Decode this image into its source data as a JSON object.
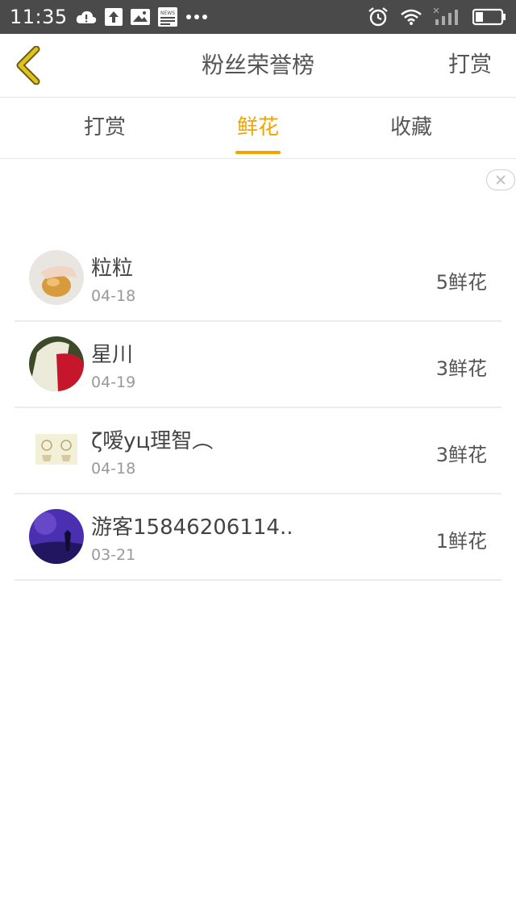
{
  "status_bar": {
    "time": "11:35",
    "icons": [
      "cloud-alert-icon",
      "upload-icon",
      "image-icon",
      "news-icon",
      "more-dots-icon"
    ],
    "right_icons": [
      "alarm-icon",
      "wifi-icon",
      "signal-icon",
      "battery-icon"
    ],
    "news_label": "NEWS"
  },
  "header": {
    "title": "粉丝荣誉榜",
    "action": "打赏",
    "accent": "#c8a300"
  },
  "tabs": [
    {
      "label": "打赏",
      "active": false
    },
    {
      "label": "鲜花",
      "active": true
    },
    {
      "label": "收藏",
      "active": false
    }
  ],
  "accent_color": "#f0a500",
  "list": [
    {
      "name": "粒粒",
      "date": "04-18",
      "count": "5鲜花"
    },
    {
      "name": "星川",
      "date": "04-19",
      "count": "3鲜花"
    },
    {
      "name": "ζ嗳уц理智︵",
      "date": "04-18",
      "count": "3鲜花"
    },
    {
      "name": "游客15846206114..",
      "date": "03-21",
      "count": "1鲜花"
    }
  ]
}
